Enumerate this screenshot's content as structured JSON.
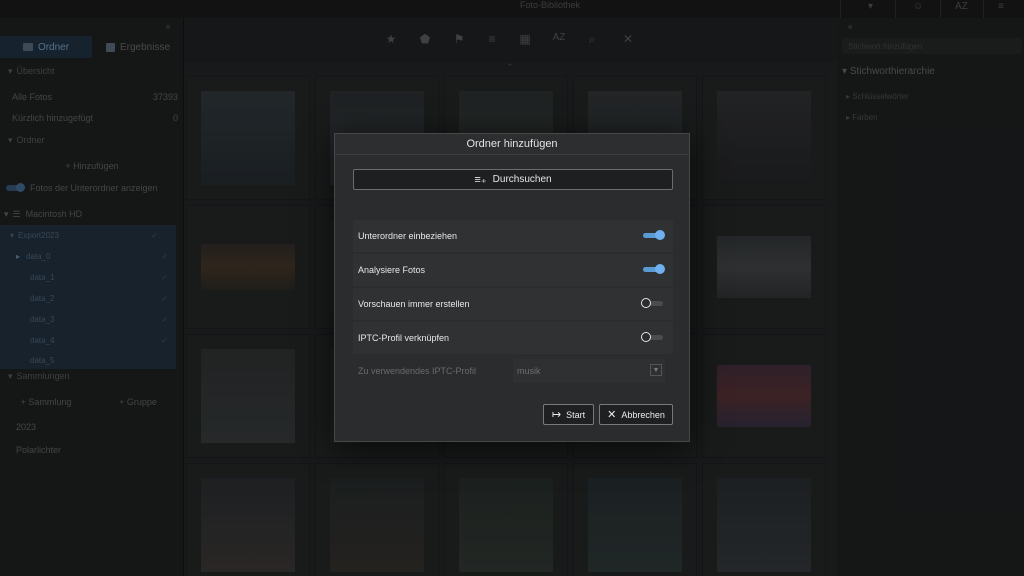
{
  "window": {
    "title": "Foto-Bibliothek"
  },
  "top_right": [
    "▾",
    "☺",
    "AZ",
    "≡"
  ],
  "left_sidebar": {
    "collapse_icon": "«",
    "tabs": [
      {
        "label": "Ordner",
        "icon": "folder-icon",
        "active": true
      },
      {
        "label": "Ergebnisse",
        "icon": "results-icon",
        "active": false
      }
    ],
    "catalog_section": "Übersicht",
    "catalog_rows": [
      {
        "label": "Alle Fotos",
        "count": "37393"
      },
      {
        "label": "Kürzlich hinzugefügt",
        "count": "0"
      }
    ],
    "folders_section": "Ordner",
    "add_label": "+ Hinzufügen",
    "subfolder_toggle_label": "Fotos der Unterordner anzeigen",
    "drive_label": "Macintosh HD",
    "folder_tree": [
      {
        "label": "Export2023",
        "level": 0
      },
      {
        "label": "data_0",
        "level": 1
      },
      {
        "label": "data_1",
        "level": 1
      },
      {
        "label": "data_2",
        "level": 1
      },
      {
        "label": "data_3",
        "level": 1
      },
      {
        "label": "data_4",
        "level": 1
      },
      {
        "label": "data_5",
        "level": 1
      }
    ],
    "collections_section": "Sammlungen",
    "collection_add": "+ Sammlung",
    "group_add": "+ Gruppe",
    "collections": [
      "2023",
      "Polarlichter"
    ]
  },
  "toolbar": {
    "icons": [
      {
        "name": "star-icon",
        "glyph": "★"
      },
      {
        "name": "tag-icon",
        "glyph": "⬟"
      },
      {
        "name": "flag-icon",
        "glyph": "⚑"
      },
      {
        "name": "list-icon",
        "glyph": "≡"
      },
      {
        "name": "calendar-icon",
        "glyph": "▦"
      },
      {
        "name": "sort-az-icon",
        "glyph": "AZ"
      },
      {
        "name": "search-icon",
        "glyph": "⌕"
      },
      {
        "name": "close-icon",
        "glyph": "✕"
      }
    ],
    "collapse_up": "⌃"
  },
  "right_sidebar": {
    "collapse_icon": "«",
    "search_placeholder": "Stichwort hinzufügen",
    "heading": "Stichworthierarchie",
    "items": [
      "Schlüsselwörter",
      "Farben"
    ]
  },
  "dialog": {
    "title": "Ordner hinzufügen",
    "browse_label": "Durchsuchen",
    "options": [
      {
        "label": "Unterordner einbeziehen",
        "on": true
      },
      {
        "label": "Analysiere Fotos",
        "on": true
      },
      {
        "label": "Vorschauen immer erstellen",
        "on": false
      },
      {
        "label": "IPTC-Profil verknüpfen",
        "on": false
      }
    ],
    "profile_label": "Zu verwendendes IPTC-Profil",
    "profile_value": "musik",
    "start_label": "Start",
    "cancel_label": "Abbrechen"
  },
  "colors": {
    "accent": "#6fb0ef",
    "dialog_bg": "#2a2c2e",
    "app_bg": "#1e1f20"
  }
}
